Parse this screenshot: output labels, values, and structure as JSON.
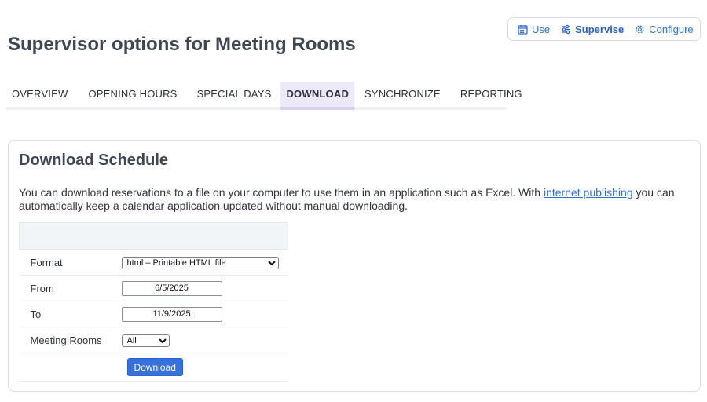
{
  "mode_switch": {
    "items": [
      {
        "label": "Use",
        "icon": "calendar-icon"
      },
      {
        "label": "Supervise",
        "icon": "sliders-icon",
        "active": true
      },
      {
        "label": "Configure",
        "icon": "gear-icon"
      }
    ]
  },
  "page_title": "Supervisor options for Meeting Rooms",
  "tabs": [
    {
      "label": "OVERVIEW"
    },
    {
      "label": "OPENING HOURS"
    },
    {
      "label": "SPECIAL DAYS"
    },
    {
      "label": "DOWNLOAD",
      "active": true
    },
    {
      "label": "SYNCHRONIZE"
    },
    {
      "label": "REPORTING"
    }
  ],
  "card": {
    "title": "Download Schedule",
    "desc_before": "You can download reservations to a file on your computer to use them in an application such as Excel. With ",
    "desc_link": "internet publishing",
    "desc_after": " you can automatically keep a calendar application updated without manual downloading."
  },
  "form": {
    "format_label": "Format",
    "format_value": "html – Printable HTML file",
    "from_label": "From",
    "from_value": "6/5/2025",
    "to_label": "To",
    "to_value": "11/9/2025",
    "rooms_label": "Meeting Rooms",
    "rooms_value": "All",
    "download_button": "Download"
  },
  "colors": {
    "accent": "#2f6fd6",
    "active_tab_bg": "#ede9f8",
    "button_bg": "#3572e0"
  }
}
